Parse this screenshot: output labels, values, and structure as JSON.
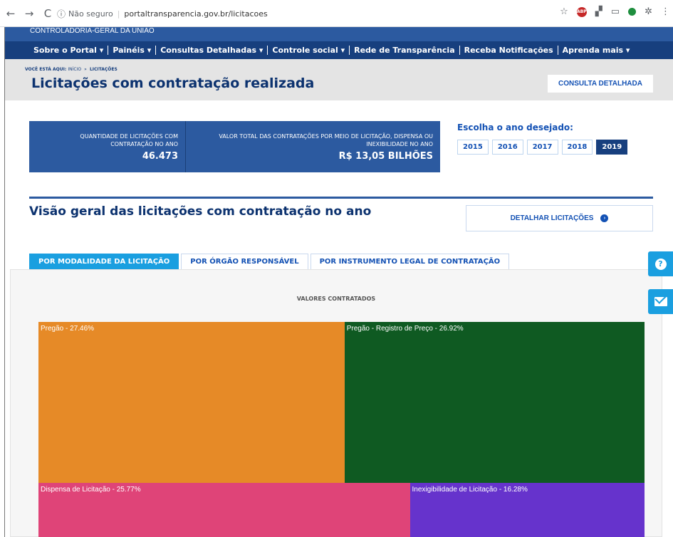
{
  "browser": {
    "back_icon": "←",
    "forward_icon": "→",
    "reload_icon": "C",
    "security_label": "Não seguro",
    "url": "portaltransparencia.gov.br/licitacoes",
    "star_icon": "☆",
    "abp_label": "ABP",
    "more_icon": "⋮"
  },
  "site": {
    "brand": "CONTROLADORIA-GERAL DA UNIÃO",
    "menu": [
      "Sobre o Portal ▾",
      "Painéis ▾",
      "Consultas Detalhadas ▾",
      "Controle social ▾",
      "Rede de Transparência",
      "Receba Notificações",
      "Aprenda mais ▾"
    ]
  },
  "hero": {
    "breadcrumb_prefix": "VOCÊ ESTÁ AQUI:",
    "breadcrumb_home": "INÍCIO",
    "breadcrumb_sep": "»",
    "breadcrumb_current": "LICITAÇÕES",
    "title": "Licitações com contratação realizada",
    "consulta_button": "CONSULTA DETALHADA"
  },
  "stats": {
    "qty_label": "QUANTIDADE DE LICITAÇÕES COM CONTRATAÇÃO NO ANO",
    "qty_value": "46.473",
    "total_label": "VALOR TOTAL DAS CONTRATAÇÕES POR MEIO DE LICITAÇÃO, DISPENSA OU INEXIBILIDADE NO ANO",
    "total_value": "R$ 13,05 BILHÕES"
  },
  "year_selector": {
    "title": "Escolha o ano desejado:",
    "years": [
      "2015",
      "2016",
      "2017",
      "2018",
      "2019"
    ],
    "selected": "2019"
  },
  "section": {
    "title": "Visão geral das licitações com contratação no ano",
    "detail_button": "DETALHAR LICITAÇÕES",
    "arrow_icon": "›"
  },
  "tabs": [
    "POR MODALIDADE DA LICITAÇÃO",
    "POR ÓRGÃO RESPONSÁVEL",
    "POR INSTRUMENTO LEGAL DE CONTRATAÇÃO"
  ],
  "side": {
    "help_icon": "?"
  },
  "chart_data": {
    "type": "treemap",
    "title": "VALORES CONTRATADOS",
    "items": [
      {
        "label": "Pregão - 27.46%",
        "name": "Pregão",
        "value": 27.46,
        "color": "#e68a27"
      },
      {
        "label": "Pregão - Registro de Preço - 26.92%",
        "name": "Pregão - Registro de Preço",
        "value": 26.92,
        "color": "#0f5a22"
      },
      {
        "label": "Dispensa de Licitação - 25.77%",
        "name": "Dispensa de Licitação",
        "value": 25.77,
        "color": "#df4478"
      },
      {
        "label": "Inexigibilidade de Licitação - 16.28%",
        "name": "Inexigibilidade de Licitação",
        "value": 16.28,
        "color": "#6633cc"
      }
    ]
  }
}
